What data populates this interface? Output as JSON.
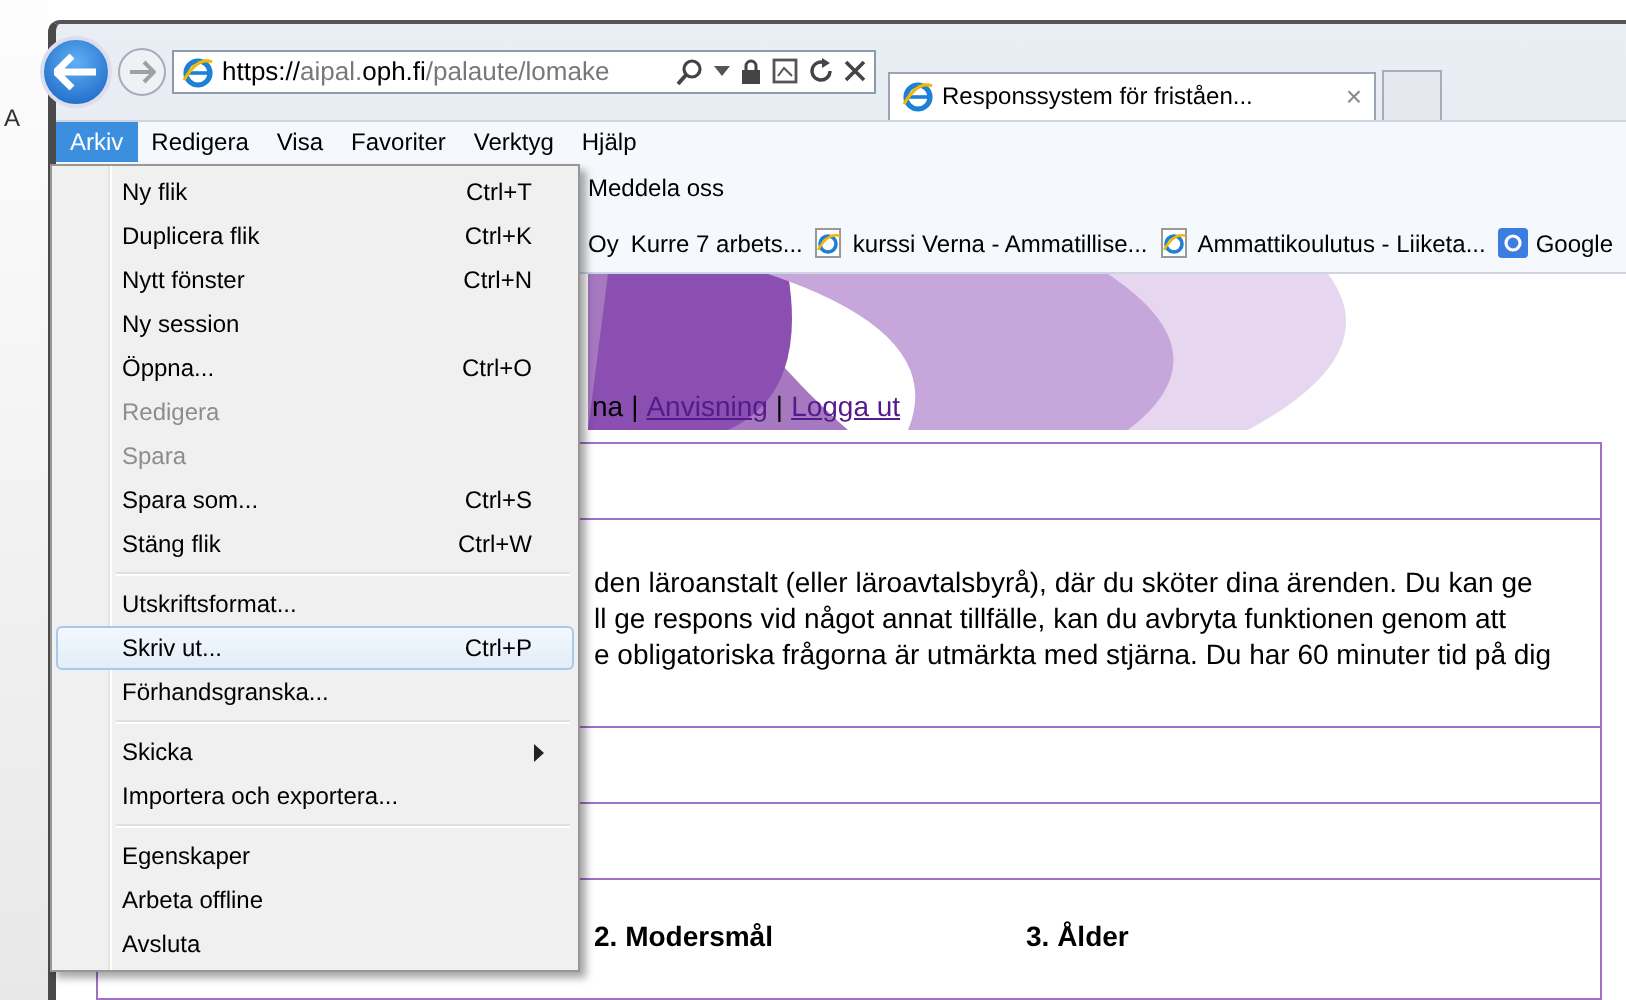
{
  "background_window": {
    "letter": "A"
  },
  "address_bar": {
    "url_parts": [
      {
        "text": "https://",
        "strong": true
      },
      {
        "text": "aipal.",
        "strong": false
      },
      {
        "text": "oph.fi",
        "strong": true
      },
      {
        "text": "/palaute/lomake",
        "strong": false
      }
    ]
  },
  "tabs": [
    {
      "title": "Responssystem för friståen...",
      "close": "×",
      "selected": true
    }
  ],
  "menu_bar": [
    {
      "label": "Arkiv",
      "selected": true
    },
    {
      "label": "Redigera",
      "selected": false
    },
    {
      "label": "Visa",
      "selected": false
    },
    {
      "label": "Favoriter",
      "selected": false
    },
    {
      "label": "Verktyg",
      "selected": false
    },
    {
      "label": "Hjälp",
      "selected": false
    }
  ],
  "command_bar": {
    "items": [
      "Meddela oss"
    ]
  },
  "favorites_bar": [
    {
      "label": "Oy",
      "icon": false
    },
    {
      "label": "Kurre 7 arbets...",
      "icon": false
    },
    {
      "label": "kurssi Verna - Ammatillise...",
      "icon": true
    },
    {
      "label": "Ammattikoulutus - Liiketa...",
      "icon": true
    },
    {
      "label": "Google",
      "icon": true
    }
  ],
  "file_menu": [
    {
      "kind": "item",
      "label": "Ny flik",
      "shortcut": "Ctrl+T",
      "disabled": false,
      "selected": false
    },
    {
      "kind": "item",
      "label": "Duplicera flik",
      "shortcut": "Ctrl+K",
      "disabled": false,
      "selected": false
    },
    {
      "kind": "item",
      "label": "Nytt fönster",
      "shortcut": "Ctrl+N",
      "disabled": false,
      "selected": false
    },
    {
      "kind": "item",
      "label": "Ny session",
      "disabled": false,
      "selected": false
    },
    {
      "kind": "item",
      "label": "Öppna...",
      "shortcut": "Ctrl+O",
      "disabled": false,
      "selected": false
    },
    {
      "kind": "item",
      "label": "Redigera",
      "disabled": true,
      "selected": false
    },
    {
      "kind": "item",
      "label": "Spara",
      "disabled": true,
      "selected": false
    },
    {
      "kind": "item",
      "label": "Spara som...",
      "shortcut": "Ctrl+S",
      "disabled": false,
      "selected": false
    },
    {
      "kind": "item",
      "label": "Stäng flik",
      "shortcut": "Ctrl+W",
      "disabled": false,
      "selected": false
    },
    {
      "kind": "separator"
    },
    {
      "kind": "item",
      "label": "Utskriftsformat...",
      "disabled": false,
      "selected": false
    },
    {
      "kind": "item",
      "label": "Skriv ut...",
      "shortcut": "Ctrl+P",
      "disabled": false,
      "selected": true
    },
    {
      "kind": "item",
      "label": "Förhandsgranska...",
      "disabled": false,
      "selected": false
    },
    {
      "kind": "separator"
    },
    {
      "kind": "submenu",
      "label": "Skicka",
      "disabled": false,
      "selected": false
    },
    {
      "kind": "item",
      "label": "Importera och exportera...",
      "disabled": false,
      "selected": false
    },
    {
      "kind": "separator"
    },
    {
      "kind": "item",
      "label": "Egenskaper",
      "disabled": false,
      "selected": false
    },
    {
      "kind": "item",
      "label": "Arbeta offline",
      "disabled": false,
      "selected": false
    },
    {
      "kind": "item",
      "label": "Avsluta",
      "disabled": false,
      "selected": false
    }
  ],
  "page": {
    "nav": [
      {
        "kind": "text",
        "text": "na"
      },
      {
        "kind": "sep",
        "text": "|"
      },
      {
        "kind": "link",
        "text": "Anvisning"
      },
      {
        "kind": "sep",
        "text": "|"
      },
      {
        "kind": "link",
        "text": "Logga ut"
      }
    ],
    "rows": [
      {
        "kind": "empty"
      },
      {
        "kind": "text",
        "lines": [
          "den läroanstalt (eller läroavtalsbyrå), där du sköter dina ärenden. Du kan ge",
          "ll ge respons vid något annat tillfälle, kan du avbryta funktionen genom att",
          "e obligatoriska frågorna är utmärkta med stjärna. Du har 60 minuter tid på dig"
        ]
      },
      {
        "kind": "empty"
      },
      {
        "kind": "empty"
      },
      {
        "kind": "questions",
        "questions": [
          "2. Modersmål",
          "3. Ålder"
        ]
      }
    ]
  }
}
